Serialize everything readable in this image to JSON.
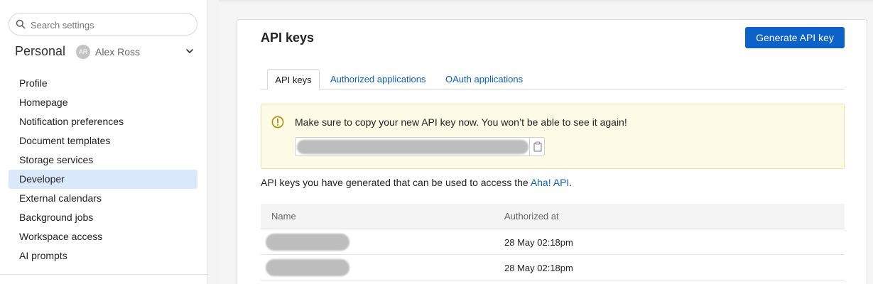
{
  "sidebar": {
    "search": {
      "placeholder": "Search settings",
      "value": ""
    },
    "workspace": "Personal",
    "user": {
      "initials": "AR",
      "name": "Alex Ross"
    },
    "items": [
      {
        "label": "Profile",
        "active": false
      },
      {
        "label": "Homepage",
        "active": false
      },
      {
        "label": "Notification preferences",
        "active": false
      },
      {
        "label": "Document templates",
        "active": false
      },
      {
        "label": "Storage services",
        "active": false
      },
      {
        "label": "Developer",
        "active": true
      },
      {
        "label": "External calendars",
        "active": false
      },
      {
        "label": "Background jobs",
        "active": false
      },
      {
        "label": "Workspace access",
        "active": false
      },
      {
        "label": "AI prompts",
        "active": false
      }
    ]
  },
  "panel": {
    "title": "API keys",
    "generate_label": "Generate API key",
    "tabs": [
      {
        "label": "API keys",
        "active": true
      },
      {
        "label": "Authorized applications",
        "active": false
      },
      {
        "label": "OAuth applications",
        "active": false
      }
    ],
    "alert": {
      "message": "Make sure to copy your new API key now. You won’t be able to see it again!"
    },
    "description": {
      "text": "API keys you have generated that can be used to access the ",
      "link": "Aha! API",
      "suffix": "."
    },
    "table": {
      "columns": [
        "Name",
        "Authorized at"
      ],
      "rows": [
        {
          "authorized_at": "28 May 02:18pm"
        },
        {
          "authorized_at": "28 May 02:18pm"
        }
      ]
    }
  },
  "colors": {
    "accent": "#0c62c9",
    "active_nav": "#d9e8fb",
    "alert_bg": "#fdfbe5",
    "warn": "#b08a00"
  }
}
